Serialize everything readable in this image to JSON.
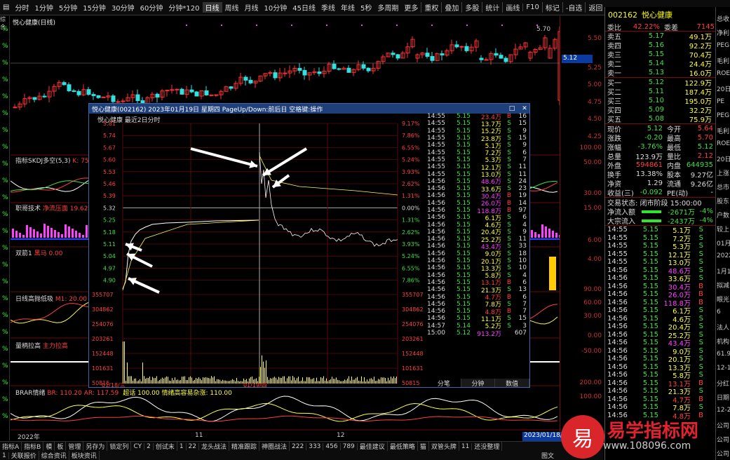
{
  "toolbar": {
    "left": [
      "分时",
      "1分钟",
      "5分钟",
      "15分钟",
      "30分钟",
      "60分钟",
      "分钟*120",
      "日线",
      "周线",
      "月线",
      "10分钟",
      "45日线",
      "季线",
      "年线",
      "5秒",
      "多周期",
      "更多"
    ],
    "right": [
      "重权",
      "叠加",
      "多股",
      "统计",
      "画线",
      "F10",
      "标记",
      "-自选",
      "返回"
    ]
  },
  "left_strip": {
    "top_label": "综合",
    "marks": [
      "%",
      "%",
      "%",
      "%",
      "%",
      "%",
      "%",
      "%",
      "%",
      "%",
      "%",
      "%",
      "%",
      "%",
      "%",
      "%",
      "%",
      "%",
      "%",
      "%",
      "%",
      "%",
      "%",
      "%"
    ]
  },
  "main": {
    "title": "悦心健康(日线)",
    "price_hi": "5.70",
    "last_price": "5.12",
    "axis_ticks": [
      "5.50",
      "5.25",
      "5.00",
      "4.75",
      "4.50",
      "4.25"
    ]
  },
  "subpanes": [
    {
      "name": "指标SKDJ多空(5,3)",
      "value": "K: 75"
    },
    {
      "name": "职哥技术",
      "value": "净流压面 19.62"
    },
    {
      "name": "双箭1",
      "value": "黑马 0.00"
    },
    {
      "name": "日线高抛低吸",
      "value": "M1: 20.00"
    },
    {
      "name": "量柄拉高",
      "value": "主力拉高"
    },
    {
      "name": "BRAR情绪",
      "value": "BR: 110.20  AR: 117.59",
      "extra": "超话 100.00  情绪高容易杂涨: 110.00"
    }
  ],
  "sub_axis": [
    [
      "100.00",
      "50.00"
    ],
    [
      "30.00",
      "15.00"
    ],
    [
      "6.00",
      "4.00"
    ],
    [
      "90.00",
      "60.00",
      "30.00"
    ],
    [
      "0.00",
      "-50.00"
    ],
    [
      "200.00",
      "100.00"
    ]
  ],
  "date_axis": [
    "2022年",
    "11",
    "12",
    "2023/01/18/四"
  ],
  "popup": {
    "title": "悦心健康(002162) 2023年01月19日 星期四 PageUp/Down:前后日 空格键:操作",
    "subtitle": "悦心健康  最近2日分时",
    "left_prices": [
      "5.81",
      "5.74",
      "5.67",
      "5.60",
      "5.53",
      "5.46",
      "5.39",
      "5.32",
      "5.25",
      "5.18",
      "5.11",
      "5.04",
      "4.97",
      "4.90",
      "355707",
      "304862",
      "254076",
      "203261",
      "152448",
      "101631",
      "50815"
    ],
    "right_pct": [
      "9.17%",
      "7.86%",
      "6.55%",
      "5.24%",
      "3.93%",
      "2.62%",
      "1.31%",
      "0.00%",
      "1.31%",
      "2.62%",
      "3.93%",
      "5.24%",
      "6.55%",
      "7.86%",
      "355707",
      "304862",
      "254076",
      "203261",
      "152448",
      "101631",
      "50815"
    ],
    "dates": [
      "01/18/三",
      "01/19/四"
    ],
    "tabs": [
      "分笔",
      "分钟",
      "数值"
    ]
  },
  "ticks_popup": [
    [
      "14:55",
      "5.15",
      "23.4万",
      "B",
      "16"
    ],
    [
      "14:55",
      "5.15",
      "13.7万",
      "S",
      "15"
    ],
    [
      "14:55",
      "5.15",
      "15.2万",
      "S",
      "9"
    ],
    [
      "14:55",
      "5.15",
      "23.8万",
      "S",
      "15"
    ],
    [
      "14:55",
      "5.15",
      "5.1万",
      "S",
      "9"
    ],
    [
      "14:55",
      "5.15",
      "7.2万",
      "S",
      "6"
    ],
    [
      "14:55",
      "5.15",
      "5.3万",
      "S",
      "7"
    ],
    [
      "14:55",
      "5.15",
      "12.1万",
      "S",
      "11"
    ],
    [
      "14:55",
      "5.15",
      "13.0万",
      "S",
      "11"
    ],
    [
      "14:56",
      "5.15",
      "48.6万",
      "S",
      "24"
    ],
    [
      "14:56",
      "5.15",
      "33.6万",
      "S",
      "23"
    ],
    [
      "14:56",
      "5.15",
      "30.4万",
      "B",
      "19"
    ],
    [
      "14:56",
      "5.15",
      "26.0万",
      "B",
      "14"
    ],
    [
      "14:56",
      "5.15",
      "118.8万",
      "B",
      "97"
    ],
    [
      "14:56",
      "5.15",
      "6.1万",
      "S",
      "6"
    ],
    [
      "14:56",
      "5.15",
      "4.6万",
      "S",
      "4"
    ],
    [
      "14:56",
      "5.15",
      "20.4万",
      "S",
      "9"
    ],
    [
      "14:56",
      "5.15",
      "25.2万",
      "S",
      "11"
    ],
    [
      "14:56",
      "5.15",
      "43.4万",
      "S",
      "33"
    ],
    [
      "14:56",
      "5.15",
      "9.0万",
      "S",
      "18"
    ],
    [
      "14:56",
      "5.15",
      "20.1万",
      "S",
      "10"
    ],
    [
      "14:56",
      "5.15",
      "13.3万",
      "S",
      "10"
    ],
    [
      "14:56",
      "5.15",
      "5.8万",
      "S",
      "4"
    ],
    [
      "14:56",
      "5.15",
      "13.1万",
      "B",
      "6"
    ],
    [
      "14:56",
      "5.15",
      "21.3万",
      "S",
      "13"
    ],
    [
      "14:56",
      "5.15",
      "4.7万",
      "B",
      "6"
    ],
    [
      "14:56",
      "5.15",
      "7.8万",
      "S",
      "7"
    ],
    [
      "14:56",
      "5.15",
      "4.8万",
      "B",
      "7"
    ],
    [
      "14:56",
      "5.15",
      "11.1万",
      "S",
      "15"
    ],
    [
      "14:57",
      "5.14",
      "5.2万",
      "S",
      "3"
    ],
    [
      "15:00",
      "5.12",
      "913.2万",
      "",
      "607"
    ]
  ],
  "right_panel": {
    "code": "002162",
    "name": "悦心健康",
    "header": {
      "label1": "委比",
      "val1": "42.22%",
      "label2": "委差",
      "val2": "7145"
    },
    "asks": [
      [
        "卖五",
        "5.17",
        "49.1万"
      ],
      [
        "卖四",
        "5.16",
        "92.2万"
      ],
      [
        "卖三",
        "5.15",
        "70.4万"
      ],
      [
        "卖二",
        "5.14",
        "24.4万"
      ],
      [
        "卖一",
        "5.13",
        "16.0万"
      ]
    ],
    "bids": [
      [
        "买一",
        "5.12",
        "122.9万"
      ],
      [
        "买二",
        "5.11",
        "187.4万"
      ],
      [
        "买三",
        "5.10",
        "195.0万"
      ],
      [
        "买四",
        "5.09",
        "32.2万"
      ],
      [
        "买五",
        "5.08",
        "75.9万"
      ]
    ],
    "stats": [
      [
        "现价",
        "5.12",
        "今开",
        "5.64"
      ],
      [
        "涨跌",
        "-0.20",
        "最高",
        "5.70"
      ],
      [
        "涨幅",
        "-3.76%",
        "最低",
        "5.12"
      ],
      [
        "总量",
        "123.9万",
        "量比",
        "2.12"
      ],
      [
        "外盘",
        "594861",
        "内盘",
        "644935"
      ],
      [
        "换手",
        "13.38%",
        "股本",
        "9.27亿"
      ],
      [
        "净资",
        "1.29",
        "流通",
        "9.26亿"
      ],
      [
        "收益(三)",
        "-0.092",
        "PE(动)",
        "-"
      ]
    ],
    "status": "交易状态: 闭市阶段 15:00:00",
    "flows": [
      [
        "净流入额",
        "-2671万",
        "-4%"
      ],
      [
        "大宗流入",
        "-2437万",
        "-4%"
      ]
    ],
    "ticks": [
      [
        "14:55",
        "5.15",
        "5.1万",
        "S"
      ],
      [
        "14:55",
        "5.15",
        "7.2万",
        "S"
      ],
      [
        "14:55",
        "5.15",
        "5.3万",
        "S"
      ],
      [
        "14:55",
        "5.15",
        "12.1万",
        "S"
      ],
      [
        "14:55",
        "5.15",
        "13.0万",
        "S"
      ],
      [
        "14:56",
        "5.15",
        "48.6万",
        "S"
      ],
      [
        "14:56",
        "5.15",
        "33.6万",
        "S"
      ],
      [
        "14:56",
        "5.15",
        "30.4万",
        "B"
      ],
      [
        "14:56",
        "5.15",
        "26.0万",
        "B"
      ],
      [
        "14:56",
        "5.15",
        "118.8万",
        "B"
      ],
      [
        "14:56",
        "5.15",
        "6.1万",
        "S"
      ],
      [
        "14:56",
        "5.15",
        "4.6万",
        "S"
      ],
      [
        "14:56",
        "5.15",
        "20.4万",
        "S"
      ],
      [
        "14:56",
        "5.15",
        "25.2万",
        "S"
      ],
      [
        "14:56",
        "5.15",
        "43.4万",
        "S"
      ],
      [
        "14:56",
        "5.15",
        "9.0万",
        "S"
      ],
      [
        "14:56",
        "5.15",
        "20.1万",
        "S"
      ],
      [
        "14:56",
        "5.15",
        "13.3万",
        "S"
      ],
      [
        "14:56",
        "5.15",
        "5.8万",
        "S"
      ],
      [
        "14:56",
        "5.15",
        "13.1万",
        "B"
      ],
      [
        "14:56",
        "5.15",
        "21.3万",
        "S"
      ],
      [
        "14:56",
        "5.15",
        "4.7万",
        "B"
      ],
      [
        "14:56",
        "5.15",
        "7.8万",
        "S"
      ],
      [
        "14:56",
        "5.15",
        "4.8万",
        "B"
      ]
    ]
  },
  "edge_panel": [
    "总收",
    "净利",
    "PEG",
    "毛利",
    "ROE",
    "20日",
    "PE",
    "PEG",
    "毛利",
    "ROE",
    "20日",
    "上涨",
    "总市",
    "股东",
    "户数",
    "较上",
    "01月",
    "2022",
    "1月1",
    "拟减",
    "眼光",
    "6",
    "法人",
    "机构",
    "61.9",
    "12-1",
    "分红",
    "日期",
    "12-2",
    "公司",
    "公司",
    "公司"
  ],
  "bottom": {
    "row1": [
      "指标A",
      "指标B",
      "模",
      "板",
      "管理",
      "另存为",
      "锁定列",
      "CY",
      "2",
      "创试末",
      "1",
      "22",
      "龙头战法",
      "精准跟踪",
      "神圈战法",
      "222",
      "333",
      "456",
      "789",
      "最佳建议",
      "最低策略",
      "猫",
      "双管头牌",
      "11",
      "还没整理"
    ],
    "row2": [
      "1",
      "关联报价",
      "综合资讯",
      "板块资讯"
    ],
    "right": "图文"
  },
  "watermark": {
    "logo": "易",
    "text": "易学指标网",
    "url": "www.108096.com"
  }
}
